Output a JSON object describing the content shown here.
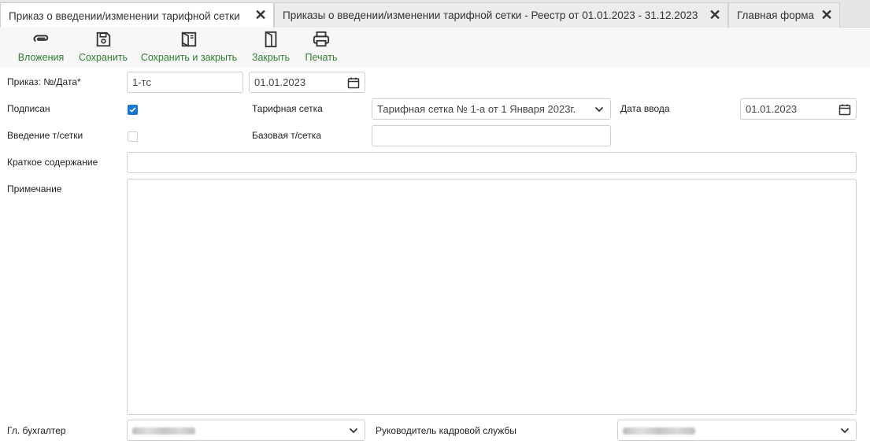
{
  "tabs": [
    {
      "label": "Приказ о введении/изменении тарифной сетки",
      "active": true
    },
    {
      "label": "Приказы о введении/изменении тарифной сетки - Реестр от 01.01.2023 - 31.12.2023",
      "active": false
    },
    {
      "label": "Главная форма",
      "active": false
    }
  ],
  "toolbar": {
    "attachments": "Вложения",
    "save": "Сохранить",
    "save_close": "Сохранить и закрыть",
    "close": "Закрыть",
    "print": "Печать"
  },
  "form": {
    "order_label": "Приказ: №/Дата*",
    "order_number": "1-тс",
    "order_date": "01.01.2023",
    "signed_label": "Подписан",
    "signed": true,
    "tariff_grid_label": "Тарифная сетка",
    "tariff_grid_value": "Тарифная сетка № 1-а от 1 Января 2023г.",
    "entry_date_label": "Дата ввода",
    "entry_date": "01.01.2023",
    "grid_intro_label": "Введение т/сетки",
    "grid_intro": false,
    "base_grid_label": "Базовая т/сетка",
    "base_grid_value": "",
    "summary_label": "Краткое содержание",
    "summary_value": "",
    "note_label": "Примечание",
    "note_value": "",
    "chief_accountant_label": "Гл. бухгалтер",
    "hr_head_label": "Руководитель кадровой службы"
  },
  "colors": {
    "accent_green": "#2e7d32",
    "checkbox_blue": "#1976d2"
  }
}
